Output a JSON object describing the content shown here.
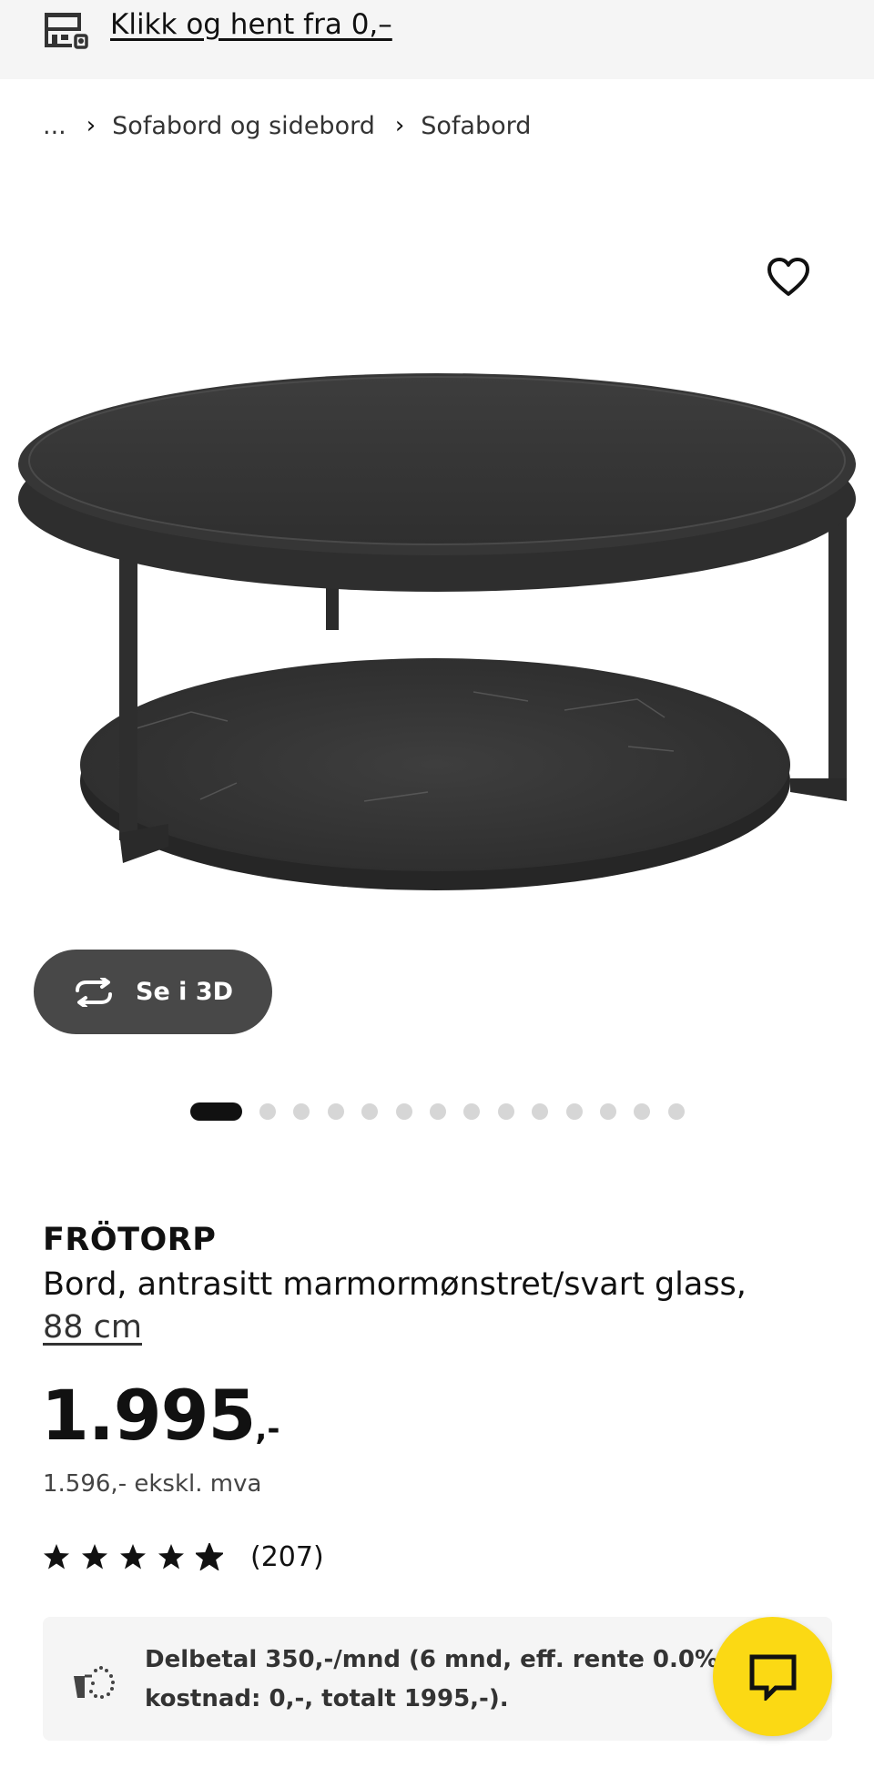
{
  "topbar": {
    "promo_text": "Klikk og hent fra 0,–",
    "icon": "store-icon"
  },
  "breadcrumb": {
    "ellipsis": "...",
    "items": [
      "Sofabord og sidebord",
      "Sofabord"
    ]
  },
  "gallery": {
    "image": "coffee-table-image",
    "favorite_icon": "heart-icon",
    "view_3d_label": "Se i 3D",
    "slide_count": 15,
    "active_slide": 1
  },
  "product": {
    "name": "FRÖTORP",
    "description": "Bord, antrasitt marmormønstret/svart glass,",
    "size": "88 cm",
    "price_main": "1.995",
    "price_suffix": ",-",
    "price_excl_vat": "1.596,- ekskl. mva",
    "rating_stars": 4.5,
    "rating_count": "(207)"
  },
  "financing": {
    "text": "Delbetal 350,-/mnd (6 mnd, eff. rente 0.0%, kostnad: 0,-, totalt 1995,-)."
  },
  "chat": {
    "icon": "chat-icon"
  },
  "colors": {
    "accent_yellow": "#fbd914",
    "dark_button": "#484848",
    "panel_bg": "#f5f5f5"
  }
}
